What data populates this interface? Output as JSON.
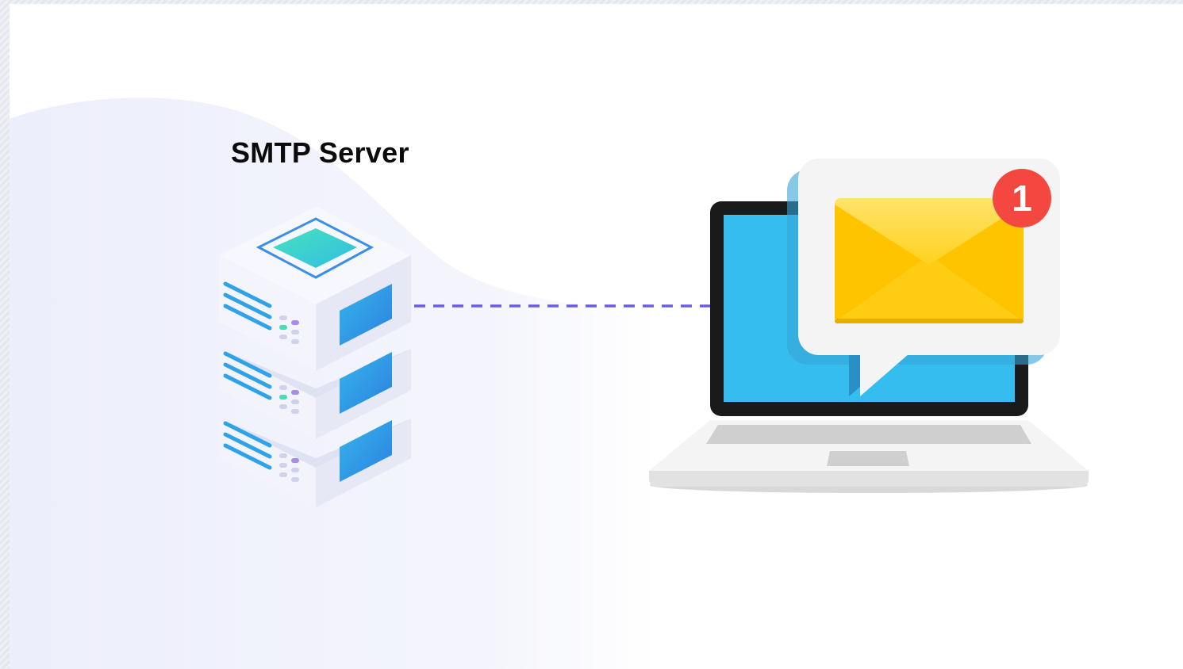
{
  "diagram": {
    "title": "SMTP Server",
    "notification_count": "1"
  },
  "nodes": [
    {
      "id": "server",
      "kind": "server-stack-icon"
    },
    {
      "id": "laptop",
      "kind": "laptop-icon"
    },
    {
      "id": "message",
      "kind": "mail-envelope-icon"
    }
  ],
  "edges": [
    {
      "from": "server",
      "to": "laptop",
      "style": "dashed"
    }
  ],
  "colors": {
    "background_wave": "#eef0fb",
    "connector": "#6b5ce7",
    "server_body": "#f2f3fb",
    "server_accent": "#2fa3ea",
    "server_top": "#3ddbb8",
    "laptop_frame": "#1a1a1a",
    "laptop_screen": "#34bdee",
    "envelope": "#ffd000",
    "badge": "#f4473f"
  }
}
